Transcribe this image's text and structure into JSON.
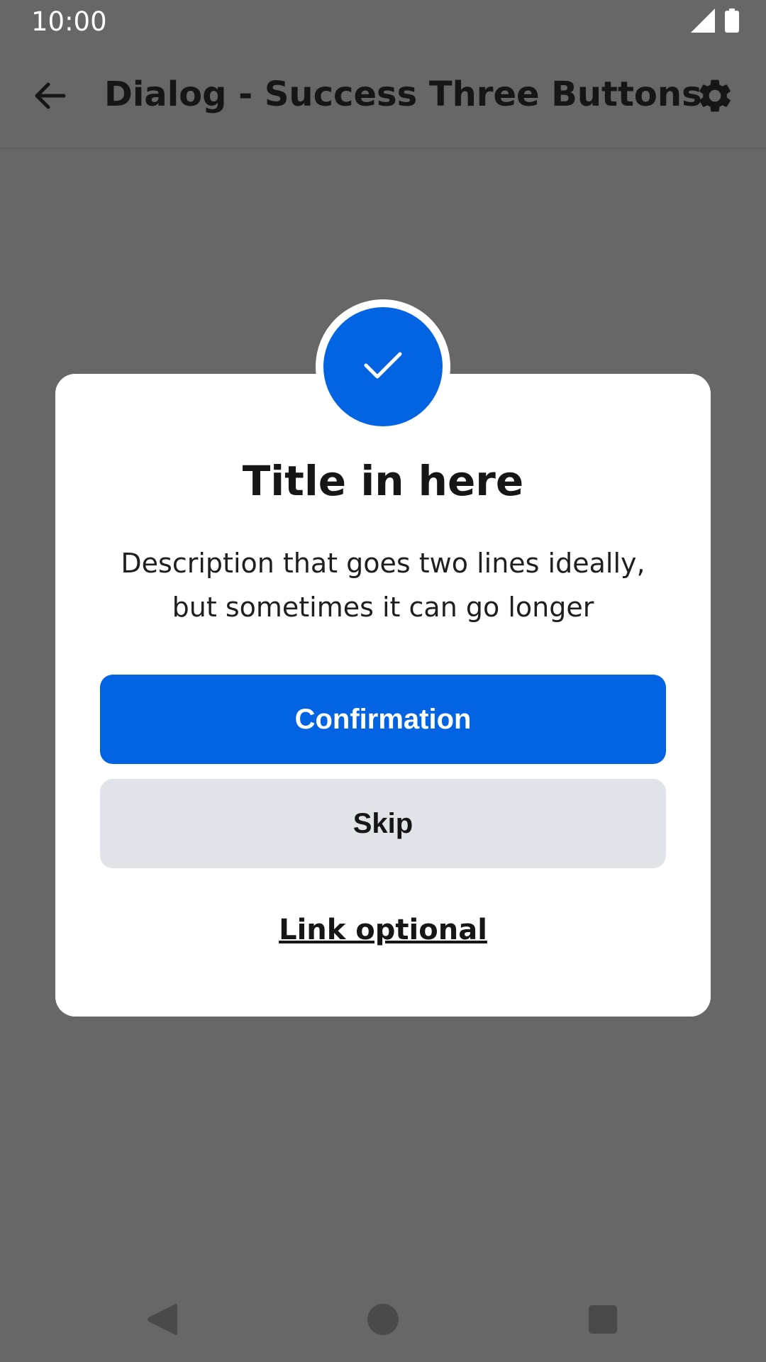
{
  "status_bar": {
    "time": "10:00",
    "icons": [
      "cell-signal-icon",
      "battery-icon"
    ]
  },
  "app_bar": {
    "back_icon": "arrow-back-icon",
    "title": "Dialog - Success Three Buttons",
    "settings_icon": "gear-icon"
  },
  "dialog": {
    "badge_icon": "check-icon",
    "title": "Title in here",
    "description": "Description that goes two lines ideally, but sometimes it can go longer",
    "primary_label": "Confirmation",
    "secondary_label": "Skip",
    "link_label": "Link optional"
  },
  "nav_bar": {
    "icons": [
      "nav-back-icon",
      "nav-home-icon",
      "nav-recents-icon"
    ]
  },
  "colors": {
    "scrim": "#676767",
    "accent": "#0264e3",
    "secondary_button": "#e0e3e8",
    "text": "#161616"
  }
}
